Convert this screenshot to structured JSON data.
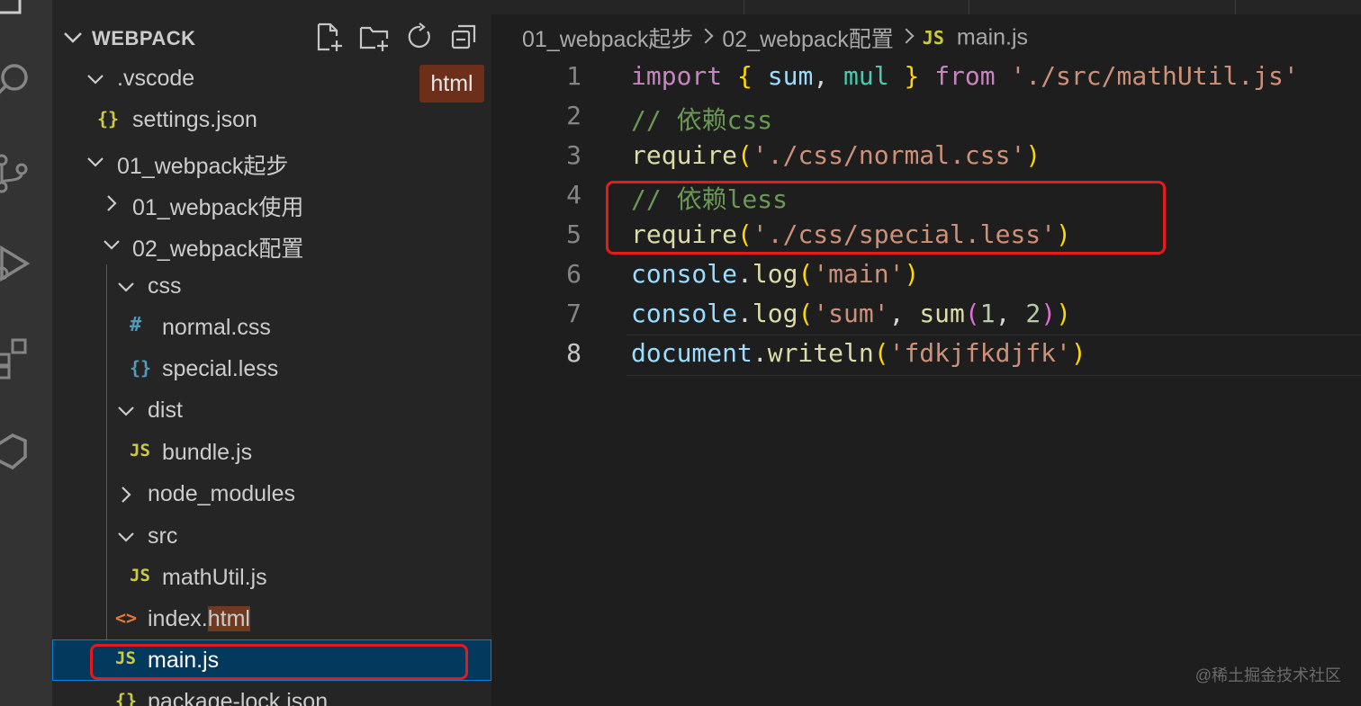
{
  "activity_bar": {
    "icons": [
      "explorer-icon",
      "search-icon",
      "source-control-icon",
      "run-debug-icon",
      "extensions-icon",
      "remote-icon"
    ]
  },
  "explorer": {
    "title": "WEBPACK",
    "header_actions": [
      "new-file-icon",
      "new-folder-icon",
      "refresh-icon",
      "collapse-all-icon"
    ],
    "tooltip_badge": "html",
    "tree": [
      {
        "label": ".vscode",
        "type": "folder",
        "expanded": true
      },
      {
        "label": "settings.json",
        "type": "json",
        "icon_text": "{}"
      },
      {
        "label": "01_webpack起步",
        "type": "folder",
        "expanded": true
      },
      {
        "label": "01_webpack使用",
        "type": "folder",
        "expanded": false
      },
      {
        "label": "02_webpack配置",
        "type": "folder",
        "expanded": true
      },
      {
        "label": "css",
        "type": "folder",
        "expanded": true
      },
      {
        "label": "normal.css",
        "type": "css",
        "icon_text": "#"
      },
      {
        "label": "special.less",
        "type": "less",
        "icon_text": "{}"
      },
      {
        "label": "dist",
        "type": "folder",
        "expanded": true
      },
      {
        "label": "bundle.js",
        "type": "js",
        "icon_text": "JS"
      },
      {
        "label": "node_modules",
        "type": "folder",
        "expanded": false
      },
      {
        "label": "src",
        "type": "folder",
        "expanded": true
      },
      {
        "label": "mathUtil.js",
        "type": "js",
        "icon_text": "JS"
      },
      {
        "label_pre": "index.",
        "label_hl": "html",
        "type": "html",
        "icon_text": "<>"
      },
      {
        "label": "main.js",
        "type": "js",
        "icon_text": "JS",
        "selected": true
      },
      {
        "label": "package-lock.json",
        "type": "json",
        "icon_text": "{}"
      }
    ]
  },
  "breadcrumb": {
    "items": [
      "01_webpack起步",
      "02_webpack配置"
    ],
    "file_icon_text": "JS",
    "file": "main.js"
  },
  "editor": {
    "line_numbers": [
      "1",
      "2",
      "3",
      "4",
      "5",
      "6",
      "7",
      "8"
    ],
    "active_line": "8",
    "lines": [
      [
        {
          "t": "import",
          "c": "kw"
        },
        {
          "t": " ",
          "c": "pl"
        },
        {
          "t": "{",
          "c": "br1"
        },
        {
          "t": " ",
          "c": "pl"
        },
        {
          "t": "sum",
          "c": "id"
        },
        {
          "t": ", ",
          "c": "pl"
        },
        {
          "t": "mul",
          "c": "cls"
        },
        {
          "t": " ",
          "c": "pl"
        },
        {
          "t": "}",
          "c": "br1"
        },
        {
          "t": " ",
          "c": "pl"
        },
        {
          "t": "from",
          "c": "kw"
        },
        {
          "t": " ",
          "c": "pl"
        },
        {
          "t": "'./src/mathUtil.js'",
          "c": "str"
        }
      ],
      [
        {
          "t": "// 依赖css",
          "c": "com"
        }
      ],
      [
        {
          "t": "require",
          "c": "fn"
        },
        {
          "t": "(",
          "c": "br1"
        },
        {
          "t": "'./css/normal.css'",
          "c": "str"
        },
        {
          "t": ")",
          "c": "br1"
        }
      ],
      [
        {
          "t": "// 依赖less",
          "c": "com"
        }
      ],
      [
        {
          "t": "require",
          "c": "fn"
        },
        {
          "t": "(",
          "c": "br1"
        },
        {
          "t": "'./css/special.less'",
          "c": "str"
        },
        {
          "t": ")",
          "c": "br1"
        }
      ],
      [
        {
          "t": "console",
          "c": "id"
        },
        {
          "t": ".",
          "c": "pl"
        },
        {
          "t": "log",
          "c": "fn"
        },
        {
          "t": "(",
          "c": "br1"
        },
        {
          "t": "'main'",
          "c": "str"
        },
        {
          "t": ")",
          "c": "br1"
        }
      ],
      [
        {
          "t": "console",
          "c": "id"
        },
        {
          "t": ".",
          "c": "pl"
        },
        {
          "t": "log",
          "c": "fn"
        },
        {
          "t": "(",
          "c": "br1"
        },
        {
          "t": "'sum'",
          "c": "str"
        },
        {
          "t": ", ",
          "c": "pl"
        },
        {
          "t": "sum",
          "c": "fn"
        },
        {
          "t": "(",
          "c": "br2"
        },
        {
          "t": "1",
          "c": "num"
        },
        {
          "t": ", ",
          "c": "pl"
        },
        {
          "t": "2",
          "c": "num"
        },
        {
          "t": ")",
          "c": "br2"
        },
        {
          "t": ")",
          "c": "br1"
        }
      ],
      [
        {
          "t": "document",
          "c": "id"
        },
        {
          "t": ".",
          "c": "pl"
        },
        {
          "t": "writeln",
          "c": "fn"
        },
        {
          "t": "(",
          "c": "br1"
        },
        {
          "t": "'fdkjfkdjfk'",
          "c": "str"
        },
        {
          "t": ")",
          "c": "br1"
        }
      ]
    ]
  },
  "watermark": "@稀土掘金技术社区",
  "colors": {
    "annotation_box": "#e51a1a",
    "selection": "#04395e",
    "html_badge": "#6e2f1a"
  }
}
